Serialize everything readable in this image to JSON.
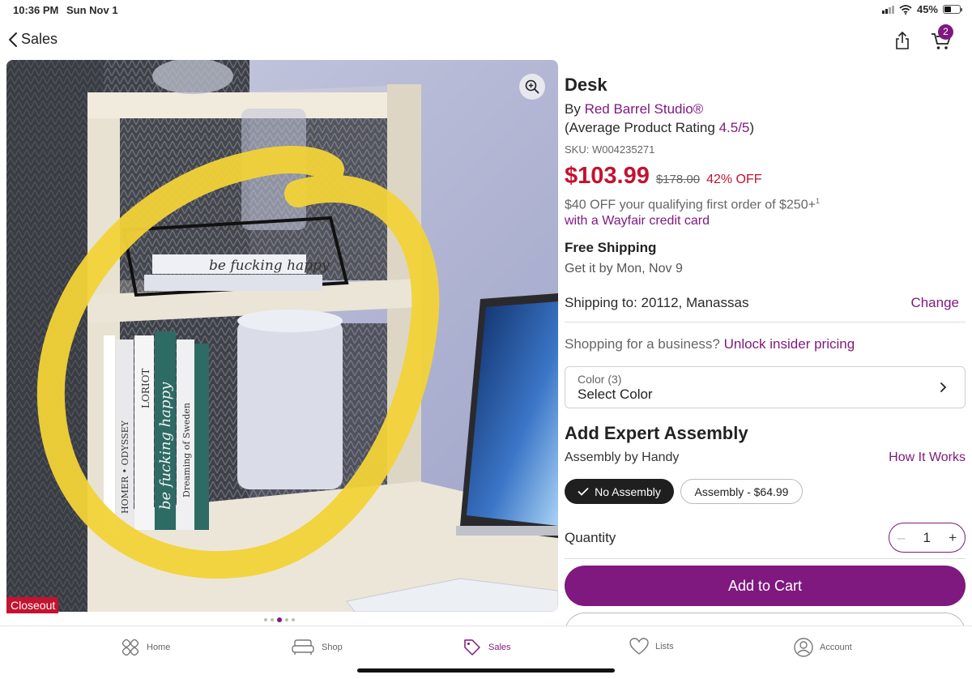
{
  "status_bar": {
    "time": "10:36 PM",
    "date": "Sun Nov 1",
    "battery": "45%",
    "battery_level": 0.45
  },
  "nav": {
    "back_label": "Sales",
    "cart_count": "2"
  },
  "gallery": {
    "badge": "Closeout",
    "dot_count": 5,
    "active_dot": 2
  },
  "product": {
    "title": "Desk",
    "by_prefix": "By ",
    "brand": "Red Barrel Studio®",
    "rating_prefix": "(Average Product Rating ",
    "rating": "4.5/5",
    "rating_suffix": ")",
    "sku": "SKU: W004235271",
    "price": "$103.99",
    "was_price": "$178.00",
    "discount": "42% OFF",
    "promo_line1": "$40 OFF your qualifying first order of $250+",
    "promo_sup": "1",
    "promo_line2": "with a Wayfair credit card",
    "free_shipping": "Free Shipping",
    "delivery": "Get it by Mon, Nov 9"
  },
  "shipping": {
    "label": "Shipping to: 20112, Manassas",
    "change_label": "Change"
  },
  "business": {
    "prefix": "Shopping for a business? ",
    "link": "Unlock insider pricing"
  },
  "color_select": {
    "label": "Color (3)",
    "value": "Select Color"
  },
  "assembly": {
    "heading": "Add Expert Assembly",
    "provider": "Assembly by Handy",
    "how_it_works": "How It Works",
    "options": [
      "No Assembly",
      "Assembly - $64.99"
    ],
    "selected": "No Assembly"
  },
  "quantity": {
    "label": "Quantity",
    "value": "1",
    "minus": "–",
    "plus": "+"
  },
  "actions": {
    "add_to_cart": "Add to Cart"
  },
  "photo_text": {
    "box_text": "be fucking happy",
    "book_1": "HOMER • ODYSSEY",
    "book_2": "LORIOT",
    "book_3": "be fucking happy",
    "book_4": "Dreaming of Sweden"
  },
  "tabs": [
    {
      "label": "Home",
      "icon": "home-icon"
    },
    {
      "label": "Shop",
      "icon": "sofa-icon"
    },
    {
      "label": "Sales",
      "icon": "tag-icon"
    },
    {
      "label": "Lists",
      "icon": "heart-icon"
    },
    {
      "label": "Account",
      "icon": "account-icon"
    }
  ],
  "active_tab": "Sales",
  "colors": {
    "brand_purple": "#7f187f",
    "sale_red": "#c4122f",
    "highlight_yellow": "#f2d338"
  }
}
